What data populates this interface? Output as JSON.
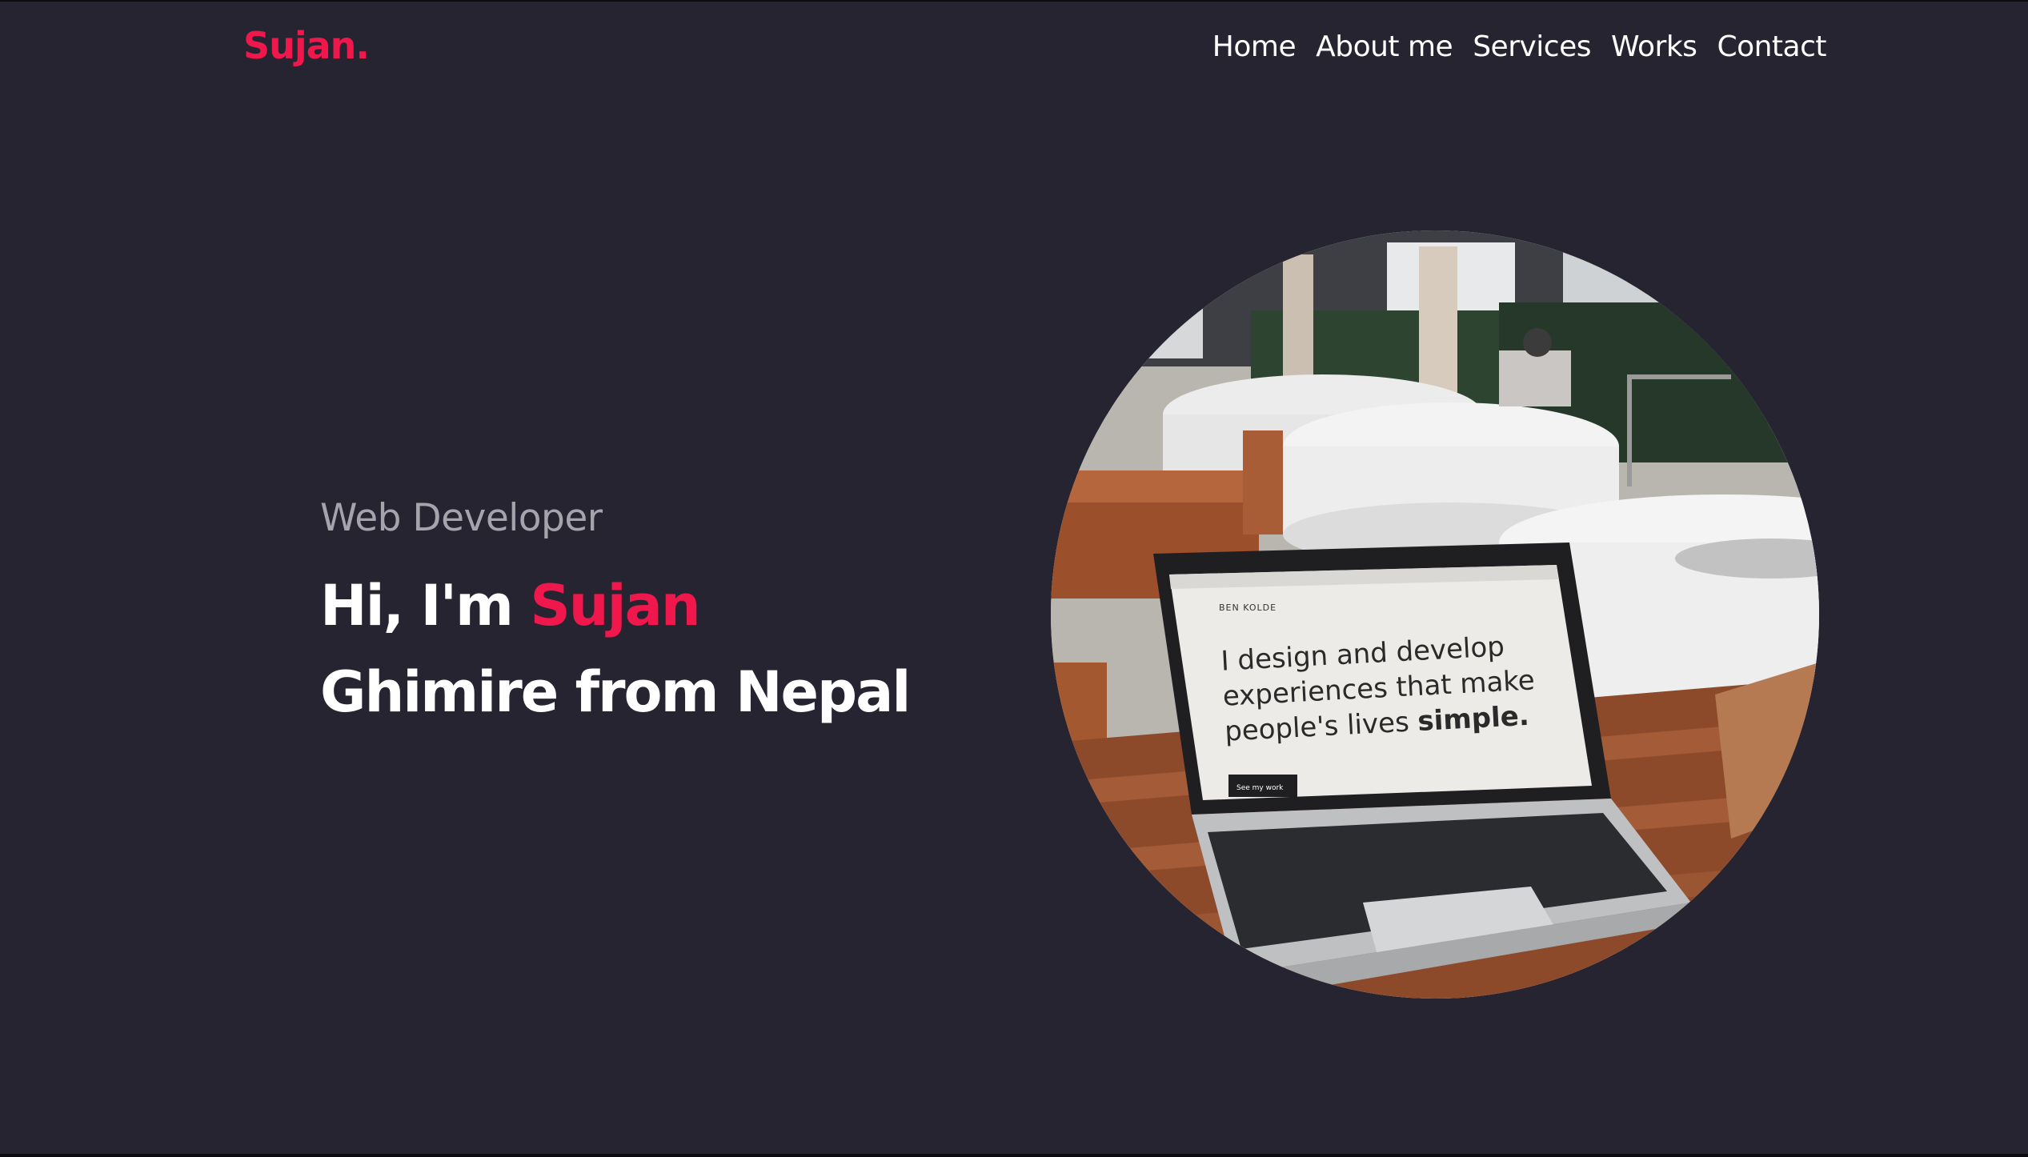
{
  "header": {
    "logo": "Sujan."
  },
  "nav": {
    "items": [
      "Home",
      "About me",
      "Services",
      "Works",
      "Contact"
    ]
  },
  "hero": {
    "role": "Web Developer",
    "greeting": "Hi, I'm",
    "name_highlight": "Sujan",
    "line2": "Ghimire from Nepal"
  },
  "laptop_screen": {
    "brand": "BEN KOLDE",
    "line1": "I design and develop",
    "line2": "experiences that make",
    "line3_prefix": "people's lives",
    "line3_bold": "simple.",
    "cta": "See my work"
  },
  "colors": {
    "accent": "#f0174d",
    "background": "#252430",
    "text": "#ffffff",
    "muted": "#a5a3ab"
  }
}
